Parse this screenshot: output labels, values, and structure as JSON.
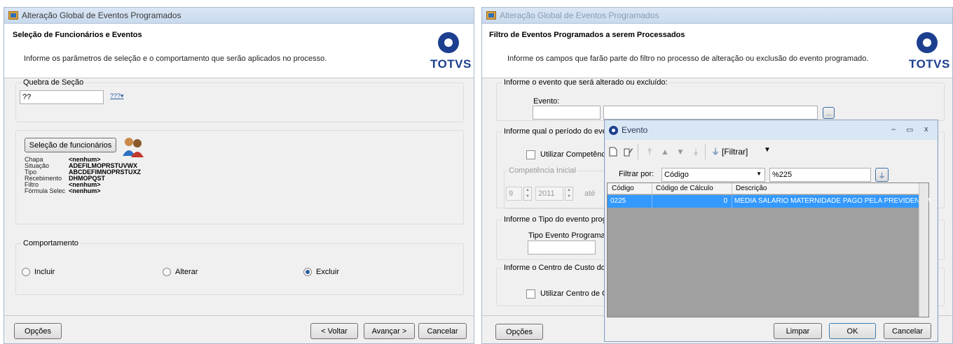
{
  "left": {
    "title": "Alteração Global de Eventos Programados",
    "header_title": "Seleção de Funcionários e Eventos",
    "header_sub": "Informe os parâmetros de seleção e o comportamento que serão aplicados no processo.",
    "logo": "TOTVS",
    "quebra": {
      "legend": "Quebra de Seção",
      "value": "??",
      "picker": "???"
    },
    "selection_button": "Seleção de funcionários",
    "filters": [
      {
        "k": "Chapa",
        "v": "<nenhum>"
      },
      {
        "k": "Situação",
        "v": "ADEFILMOPRSTUVWX"
      },
      {
        "k": "Tipo",
        "v": "ABCDEFIMNOPRSTUXZ"
      },
      {
        "k": "Recebimento",
        "v": "DHMOPQST"
      },
      {
        "k": "Filtro",
        "v": "<nenhum>"
      },
      {
        "k": "Fórmula Selec",
        "v": "<nenhum>"
      }
    ],
    "comportamento": {
      "legend": "Comportamento",
      "options": [
        "Incluir",
        "Alterar",
        "Excluir"
      ],
      "selected": "Excluir"
    },
    "buttons": {
      "opcoes": "Opções",
      "voltar": "< Voltar",
      "avancar": "Avançar >",
      "cancelar": "Cancelar"
    }
  },
  "right": {
    "title": "Alteração Global de Eventos Programados",
    "header_title": "Filtro de Eventos Programados a serem Processados",
    "header_sub": "Informe os campos que farão parte do filtro no processo de alteração ou exclusão do evento programado.",
    "logo": "TOTVS",
    "evento_group": {
      "legend": "Informe o evento que será alterado ou excluído:",
      "label": "Evento:",
      "browse": "..."
    },
    "periodo_group": {
      "legend": "Informe qual o período do ever",
      "checkbox": "Utilizar Competência",
      "comp_legend": "Competência Inicial",
      "month": "9",
      "year": "2011",
      "ate": "até"
    },
    "tipo_group": {
      "legend": "Informe o Tipo do evento prog",
      "label": "Tipo Evento Programad"
    },
    "centro_group": {
      "legend": "Informe o Centro de Custo do",
      "checkbox": "Utilizar Centro de Cu"
    },
    "buttons": {
      "opcoes": "Opções"
    }
  },
  "dialog": {
    "title": "Evento",
    "controls": {
      "min": "–",
      "max": "▭",
      "close": "x"
    },
    "toolbar": {
      "filtrar": "[Filtrar]"
    },
    "filter_label": "Filtrar por:",
    "filter_field": "Código",
    "filter_value": "%225",
    "columns": [
      "Código",
      "Código de Cálculo",
      "Descrição"
    ],
    "rows": [
      {
        "codigo": "0225",
        "calculo": "0",
        "descricao": "MEDIA SALARIO MATERNIDADE PAGO PELA PREVIDENCIA"
      }
    ],
    "buttons": {
      "limpar": "Limpar",
      "ok": "OK",
      "cancelar": "Cancelar"
    }
  }
}
